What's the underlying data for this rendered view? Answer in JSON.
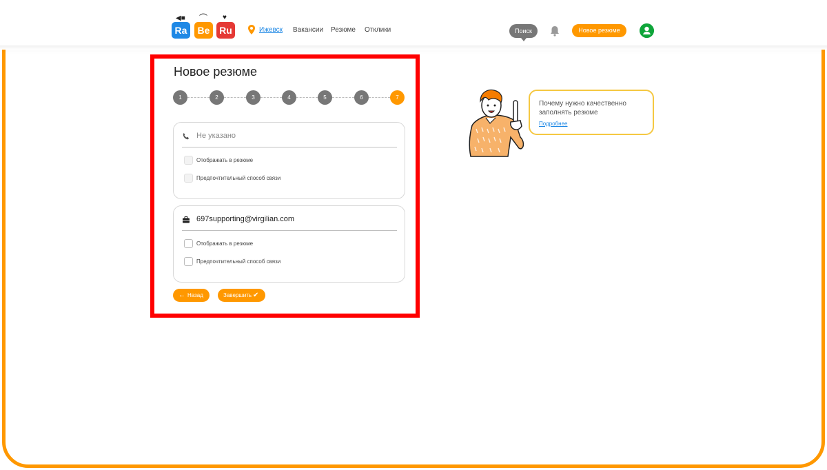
{
  "logo": {
    "tiles": [
      "Ra",
      "Be",
      "Ru"
    ]
  },
  "header": {
    "city": "Ижевск",
    "nav": [
      "Вакансии",
      "Резюме",
      "Отклики"
    ],
    "search_label": "Поиск",
    "new_resume_label": "Новое резюме"
  },
  "form": {
    "title": "Новое резюме",
    "steps": [
      "1",
      "2",
      "3",
      "4",
      "5",
      "6",
      "7"
    ],
    "active_step": 7,
    "phone_card": {
      "value": "Не указано",
      "show_label": "Отображать в резюме",
      "preferred_label": "Предпочтительный способ связи"
    },
    "email_card": {
      "value": "697supporting@virgilian.com",
      "show_label": "Отображать в резюме",
      "preferred_label": "Предпочтительный способ связи"
    },
    "back_label": "Назад",
    "finish_label": "Завершить"
  },
  "tip": {
    "text": "Почему нужно качественно заполнять резюме",
    "link": "Подробнее"
  },
  "colors": {
    "accent": "#ff9800",
    "highlight": "#ff0000",
    "link": "#1e88e5",
    "avatar": "#0fa53a"
  }
}
